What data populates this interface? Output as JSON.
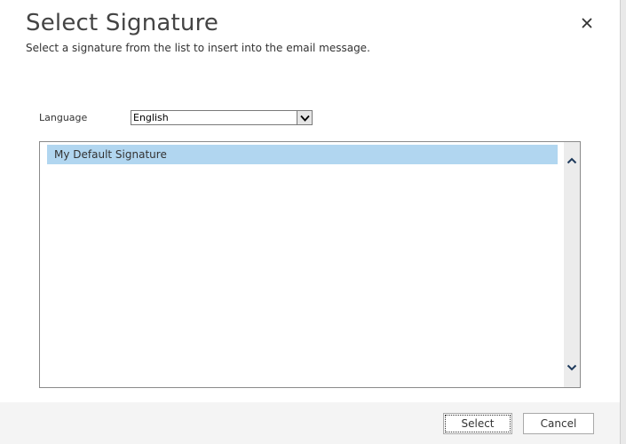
{
  "dialog": {
    "title": "Select Signature",
    "subtitle": "Select a signature from the list to insert into the email message.",
    "close_icon": "close-icon"
  },
  "language": {
    "label": "Language",
    "selected": "English"
  },
  "signatures": {
    "items": [
      {
        "label": "My Default Signature",
        "selected": true
      }
    ]
  },
  "footer": {
    "select_label": "Select",
    "cancel_label": "Cancel"
  },
  "colors": {
    "selection": "#b1d6f0",
    "footer_bg": "#f4f4f4"
  }
}
